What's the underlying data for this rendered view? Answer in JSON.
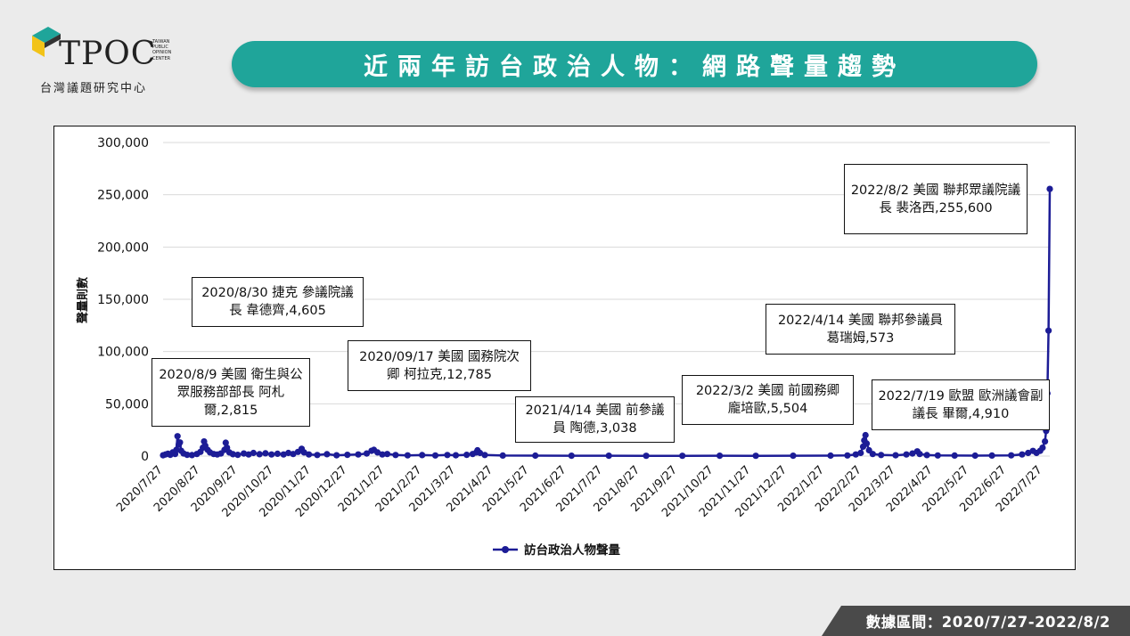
{
  "logo": {
    "wordmark": "TPOC",
    "small_text": "TAIWAN PUBLIC OPINION CENTER",
    "subtitle": "台灣議題研究中心"
  },
  "title": "近兩年訪台政治人物：網路聲量趨勢",
  "footer": "數據區間：2020/7/27-2022/8/2",
  "colors": {
    "series": "#1c1c96",
    "banner": "#1fa59a",
    "footer": "#4a4a4a"
  },
  "chart_data": {
    "type": "line",
    "ylabel": "聲量則數",
    "ylim": [
      0,
      300000
    ],
    "y_ticks": [
      0,
      50000,
      100000,
      150000,
      200000,
      250000,
      300000
    ],
    "y_tick_labels": [
      "0",
      "50,000",
      "100,000",
      "150,000",
      "200,000",
      "250,000",
      "300,000"
    ],
    "x_range": [
      "2020-07-27",
      "2022-08-02"
    ],
    "x_tick_labels": [
      "2020/7/27",
      "2020/8/27",
      "2020/9/27",
      "2020/10/27",
      "2020/11/27",
      "2020/12/27",
      "2021/1/27",
      "2021/2/27",
      "2021/3/27",
      "2021/4/27",
      "2021/5/27",
      "2021/6/27",
      "2021/7/27",
      "2021/8/27",
      "2021/9/27",
      "2021/10/27",
      "2021/11/27",
      "2021/12/27",
      "2022/1/27",
      "2022/2/27",
      "2022/3/27",
      "2022/4/27",
      "2022/5/27",
      "2022/6/27",
      "2022/7/27"
    ],
    "grid": true,
    "legend_position": "bottom",
    "series": [
      {
        "name": "訪台政治人物聲量",
        "points": [
          [
            "2020-07-27",
            800
          ],
          [
            "2020-07-29",
            1500
          ],
          [
            "2020-07-31",
            2200
          ],
          [
            "2020-08-02",
            1200
          ],
          [
            "2020-08-04",
            3500
          ],
          [
            "2020-08-06",
            2000
          ],
          [
            "2020-08-07",
            6000
          ],
          [
            "2020-08-08",
            19000
          ],
          [
            "2020-08-09",
            11000
          ],
          [
            "2020-08-10",
            13000
          ],
          [
            "2020-08-11",
            5000
          ],
          [
            "2020-08-13",
            2500
          ],
          [
            "2020-08-16",
            1200
          ],
          [
            "2020-08-20",
            900
          ],
          [
            "2020-08-24",
            2000
          ],
          [
            "2020-08-27",
            4000
          ],
          [
            "2020-08-29",
            8000
          ],
          [
            "2020-08-30",
            14000
          ],
          [
            "2020-08-31",
            10000
          ],
          [
            "2020-09-02",
            6000
          ],
          [
            "2020-09-04",
            3500
          ],
          [
            "2020-09-07",
            2000
          ],
          [
            "2020-09-10",
            1500
          ],
          [
            "2020-09-13",
            2500
          ],
          [
            "2020-09-16",
            6000
          ],
          [
            "2020-09-17",
            12785
          ],
          [
            "2020-09-18",
            8000
          ],
          [
            "2020-09-20",
            3500
          ],
          [
            "2020-09-23",
            1800
          ],
          [
            "2020-09-27",
            1200
          ],
          [
            "2020-10-02",
            2500
          ],
          [
            "2020-10-06",
            1500
          ],
          [
            "2020-10-10",
            3000
          ],
          [
            "2020-10-15",
            1800
          ],
          [
            "2020-10-20",
            2600
          ],
          [
            "2020-10-25",
            1500
          ],
          [
            "2020-10-30",
            2200
          ],
          [
            "2020-11-04",
            1500
          ],
          [
            "2020-11-08",
            3000
          ],
          [
            "2020-11-12",
            2000
          ],
          [
            "2020-11-16",
            4000
          ],
          [
            "2020-11-19",
            7000
          ],
          [
            "2020-11-21",
            3500
          ],
          [
            "2020-11-25",
            1500
          ],
          [
            "2020-12-02",
            1000
          ],
          [
            "2020-12-10",
            1800
          ],
          [
            "2020-12-18",
            800
          ],
          [
            "2020-12-27",
            1200
          ],
          [
            "2021-01-05",
            1500
          ],
          [
            "2021-01-12",
            2500
          ],
          [
            "2021-01-16",
            5000
          ],
          [
            "2021-01-18",
            6000
          ],
          [
            "2021-01-21",
            3500
          ],
          [
            "2021-01-25",
            1500
          ],
          [
            "2021-01-29",
            2000
          ],
          [
            "2021-02-05",
            1000
          ],
          [
            "2021-02-15",
            700
          ],
          [
            "2021-02-27",
            900
          ],
          [
            "2021-03-10",
            600
          ],
          [
            "2021-03-20",
            1000
          ],
          [
            "2021-03-27",
            800
          ],
          [
            "2021-04-05",
            1200
          ],
          [
            "2021-04-10",
            2000
          ],
          [
            "2021-04-13",
            3500
          ],
          [
            "2021-04-14",
            5500
          ],
          [
            "2021-04-16",
            3000
          ],
          [
            "2021-04-20",
            1000
          ],
          [
            "2021-05-05",
            500
          ],
          [
            "2021-06-01",
            400
          ],
          [
            "2021-07-01",
            300
          ],
          [
            "2021-08-01",
            300
          ],
          [
            "2021-09-01",
            250
          ],
          [
            "2021-10-01",
            250
          ],
          [
            "2021-11-01",
            300
          ],
          [
            "2021-12-01",
            250
          ],
          [
            "2022-01-01",
            300
          ],
          [
            "2022-02-01",
            400
          ],
          [
            "2022-02-15",
            600
          ],
          [
            "2022-02-22",
            1500
          ],
          [
            "2022-02-26",
            3000
          ],
          [
            "2022-02-28",
            9000
          ],
          [
            "2022-03-01",
            15000
          ],
          [
            "2022-03-02",
            20000
          ],
          [
            "2022-03-03",
            12000
          ],
          [
            "2022-03-05",
            5504
          ],
          [
            "2022-03-08",
            2000
          ],
          [
            "2022-03-15",
            1000
          ],
          [
            "2022-03-27",
            800
          ],
          [
            "2022-04-05",
            1500
          ],
          [
            "2022-04-10",
            2500
          ],
          [
            "2022-04-14",
            4500
          ],
          [
            "2022-04-16",
            2000
          ],
          [
            "2022-04-22",
            900
          ],
          [
            "2022-05-01",
            600
          ],
          [
            "2022-05-15",
            500
          ],
          [
            "2022-06-01",
            450
          ],
          [
            "2022-06-15",
            500
          ],
          [
            "2022-07-01",
            700
          ],
          [
            "2022-07-10",
            1500
          ],
          [
            "2022-07-15",
            3000
          ],
          [
            "2022-07-19",
            4910
          ],
          [
            "2022-07-22",
            3000
          ],
          [
            "2022-07-25",
            5000
          ],
          [
            "2022-07-27",
            8000
          ],
          [
            "2022-07-29",
            14000
          ],
          [
            "2022-07-30",
            24000
          ],
          [
            "2022-07-31",
            60000
          ],
          [
            "2022-08-01",
            120000
          ],
          [
            "2022-08-02",
            255600
          ]
        ]
      }
    ],
    "annotations": [
      {
        "text": "2020/8/30 捷克 參議院議長 韋德齊,4,605"
      },
      {
        "text": "2020/8/9 美國 衛生與公眾服務部部長 阿札爾,2,815"
      },
      {
        "text": "2020/09/17 美國 國務院次卿 柯拉克,12,785"
      },
      {
        "text": "2021/4/14 美國 前參議員 陶德,3,038"
      },
      {
        "text": "2022/3/2 美國 前國務卿 龐培歐,5,504"
      },
      {
        "text": "2022/4/14 美國 聯邦參議員 葛瑞姆,573"
      },
      {
        "text": "2022/7/19 歐盟 歐洲議會副議長 畢爾,4,910"
      },
      {
        "text": "2022/8/2 美國 聯邦眾議院議長 裴洛西,255,600"
      }
    ]
  }
}
